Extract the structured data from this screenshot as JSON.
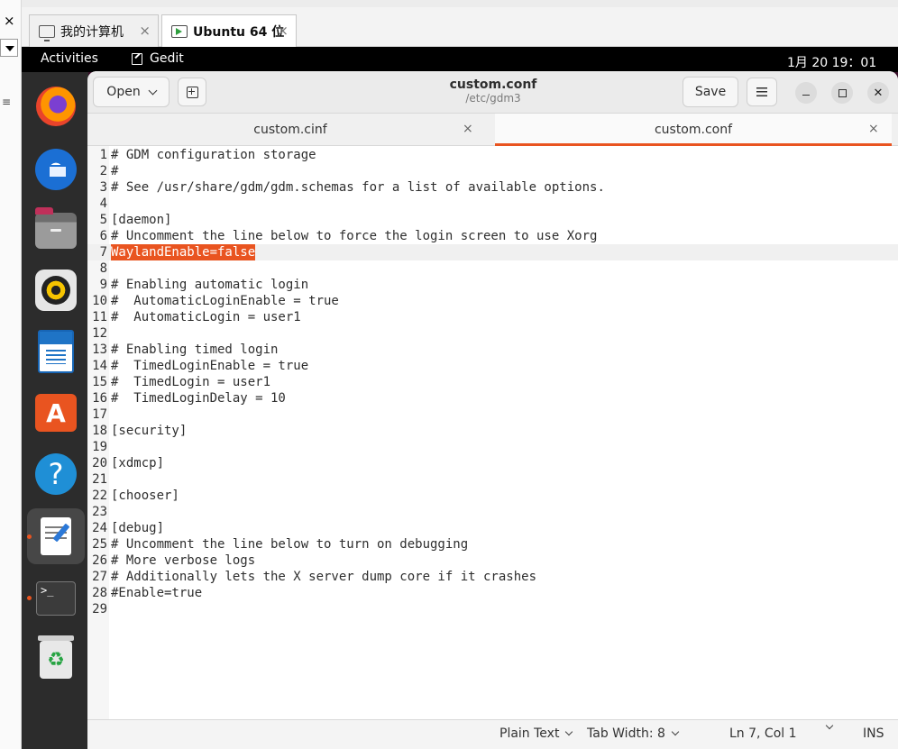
{
  "host": {
    "left_close": "×",
    "left_mark": "≡",
    "tabs": [
      {
        "label": "我的计算机",
        "close": "×"
      },
      {
        "label": "Ubuntu 64 位",
        "close": "×"
      }
    ]
  },
  "topbar": {
    "activities": "Activities",
    "app_name": "Gedit",
    "clock": "1月 20  19：01"
  },
  "dock": {
    "apps": [
      "firefox",
      "thunderbird",
      "files",
      "rhythmbox",
      "libreoffice-writer",
      "ubuntu-software",
      "help",
      "gedit",
      "terminal",
      "trash"
    ],
    "store_glyph": "A",
    "help_glyph": "?",
    "terminal_glyph": ">_",
    "trash_glyph": "♻"
  },
  "header": {
    "open_label": "Open",
    "title": "custom.conf",
    "subtitle": "/etc/gdm3",
    "save_label": "Save",
    "close_glyph": "✕"
  },
  "tabs": [
    {
      "label": "custom.cinf",
      "close": "×"
    },
    {
      "label": "custom.conf",
      "close": "×"
    }
  ],
  "editor": {
    "current_line": 7,
    "lines": [
      {
        "n": "1",
        "text": "# GDM configuration storage"
      },
      {
        "n": "2",
        "text": "#"
      },
      {
        "n": "3",
        "text": "# See /usr/share/gdm/gdm.schemas for a list of available options."
      },
      {
        "n": "4",
        "text": ""
      },
      {
        "n": "5",
        "text": "[daemon]"
      },
      {
        "n": "6",
        "text": "# Uncomment the line below to force the login screen to use Xorg"
      },
      {
        "n": "7",
        "text": "WaylandEnable=false"
      },
      {
        "n": "8",
        "text": ""
      },
      {
        "n": "9",
        "text": "# Enabling automatic login"
      },
      {
        "n": "10",
        "text": "#  AutomaticLoginEnable = true"
      },
      {
        "n": "11",
        "text": "#  AutomaticLogin = user1"
      },
      {
        "n": "12",
        "text": ""
      },
      {
        "n": "13",
        "text": "# Enabling timed login"
      },
      {
        "n": "14",
        "text": "#  TimedLoginEnable = true"
      },
      {
        "n": "15",
        "text": "#  TimedLogin = user1"
      },
      {
        "n": "16",
        "text": "#  TimedLoginDelay = 10"
      },
      {
        "n": "17",
        "text": ""
      },
      {
        "n": "18",
        "text": "[security]"
      },
      {
        "n": "19",
        "text": ""
      },
      {
        "n": "20",
        "text": "[xdmcp]"
      },
      {
        "n": "21",
        "text": ""
      },
      {
        "n": "22",
        "text": "[chooser]"
      },
      {
        "n": "23",
        "text": ""
      },
      {
        "n": "24",
        "text": "[debug]"
      },
      {
        "n": "25",
        "text": "# Uncomment the line below to turn on debugging"
      },
      {
        "n": "26",
        "text": "# More verbose logs"
      },
      {
        "n": "27",
        "text": "# Additionally lets the X server dump core if it crashes"
      },
      {
        "n": "28",
        "text": "#Enable=true"
      },
      {
        "n": "29",
        "text": ""
      }
    ]
  },
  "status": {
    "language": "Plain Text",
    "tab_width": "Tab Width: 8",
    "position": "Ln 7, Col 1",
    "mode": "INS"
  },
  "colors": {
    "accent": "#e95420",
    "dock_bg": "#2c2c2c",
    "topbar_bg": "#000000"
  }
}
